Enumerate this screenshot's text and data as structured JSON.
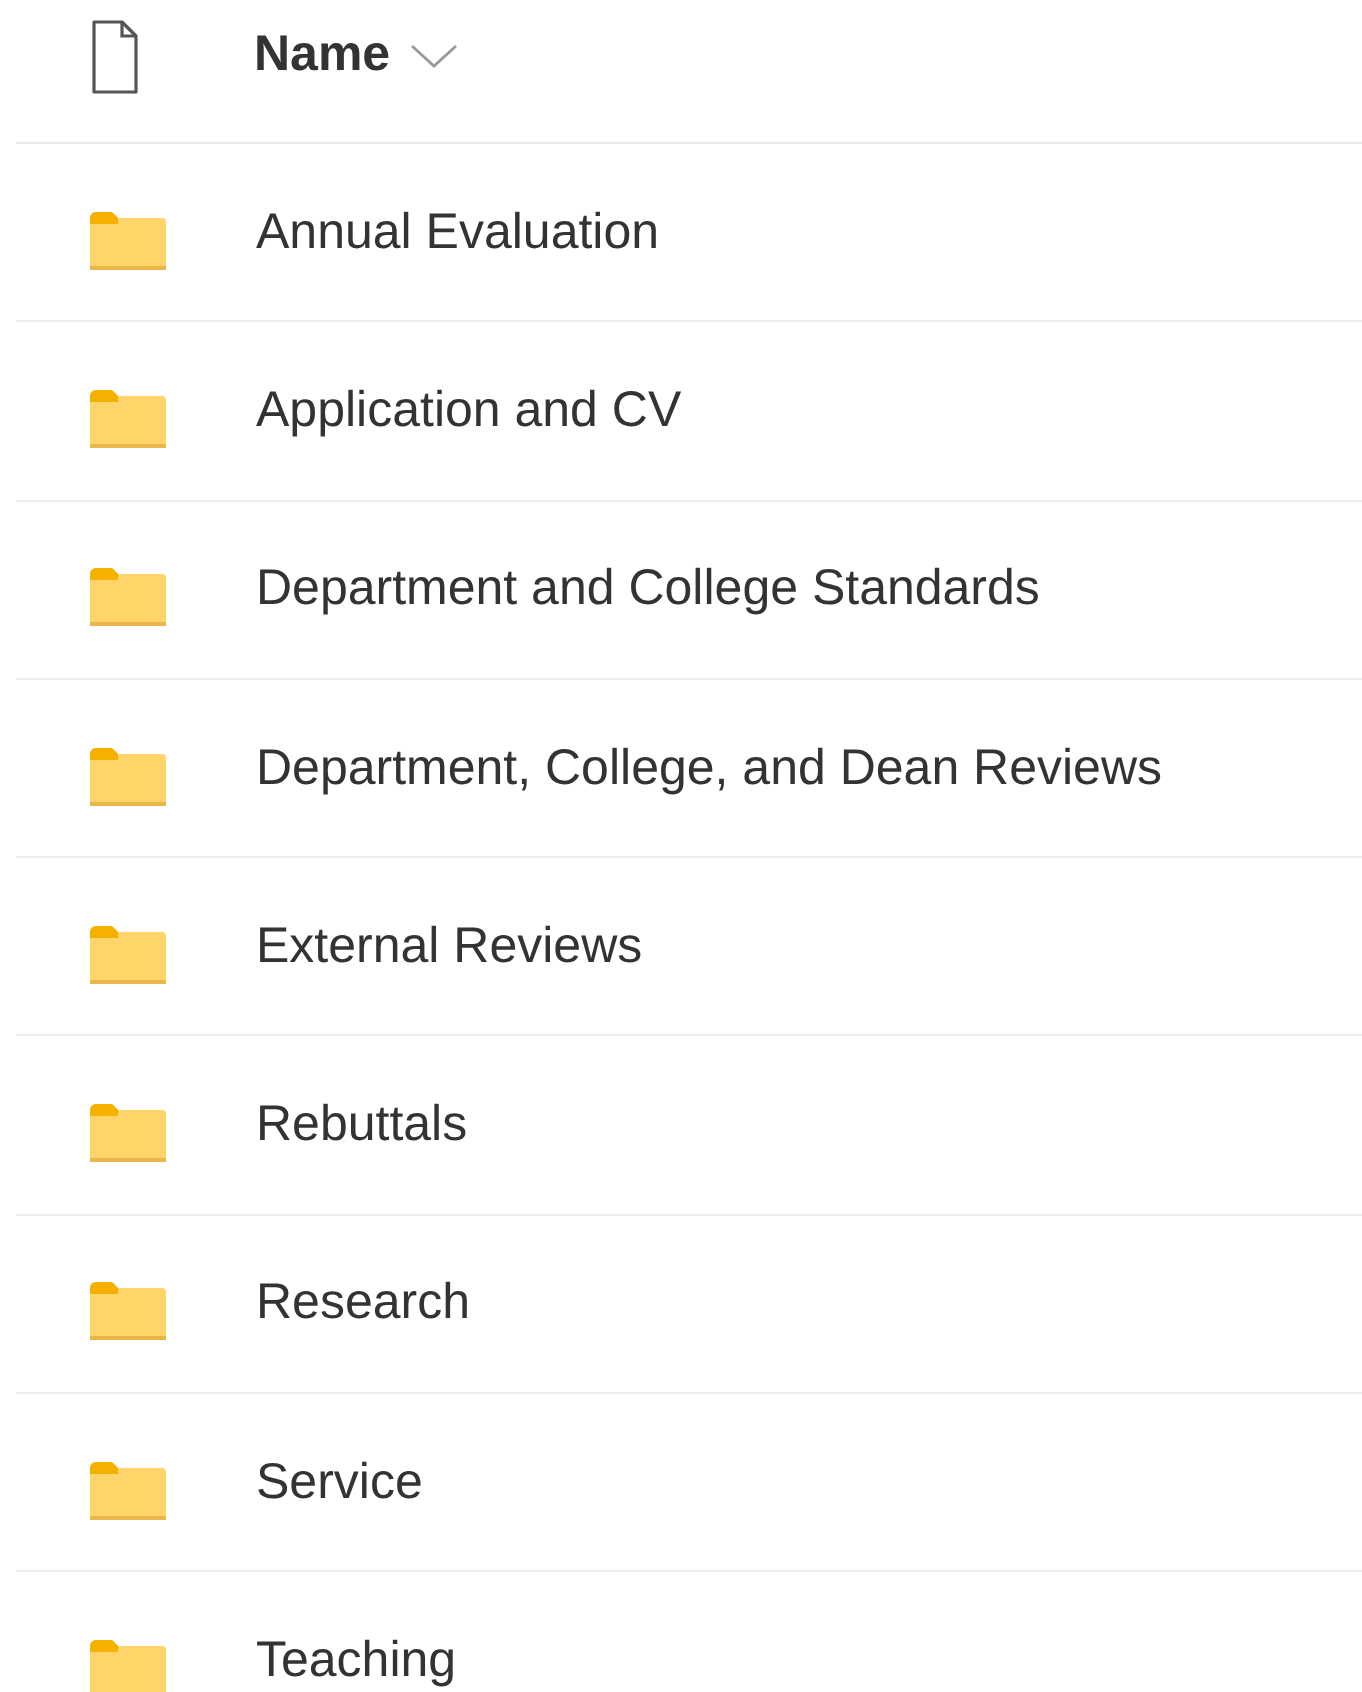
{
  "header": {
    "column": "Name",
    "sorted": true
  },
  "items": [
    {
      "name": "Annual Evaluation",
      "kind": "folder"
    },
    {
      "name": "Application and CV",
      "kind": "folder"
    },
    {
      "name": "Department and College Standards",
      "kind": "folder"
    },
    {
      "name": "Department, College, and Dean Reviews",
      "kind": "folder"
    },
    {
      "name": "External Reviews",
      "kind": "folder"
    },
    {
      "name": "Rebuttals",
      "kind": "folder"
    },
    {
      "name": "Research",
      "kind": "folder"
    },
    {
      "name": "Service",
      "kind": "folder"
    },
    {
      "name": "Teaching",
      "kind": "folder"
    }
  ]
}
